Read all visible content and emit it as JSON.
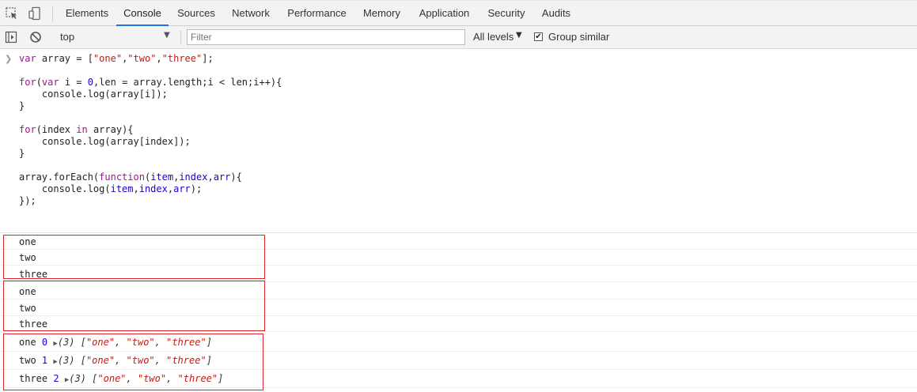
{
  "tabs": [
    {
      "label": "Elements",
      "active": false
    },
    {
      "label": "Console",
      "active": true
    },
    {
      "label": "Sources",
      "active": false
    },
    {
      "label": "Network",
      "active": false
    },
    {
      "label": "Performance",
      "active": false
    },
    {
      "label": "Memory",
      "active": false
    },
    {
      "label": "Application",
      "active": false
    },
    {
      "label": "Security",
      "active": false
    },
    {
      "label": "Audits",
      "active": false
    }
  ],
  "toolbar": {
    "context": "top",
    "filter_placeholder": "Filter",
    "levels": "All levels",
    "group_similar_label": "Group similar",
    "group_similar_checked": true
  },
  "icons": {
    "inspect": "inspect-element-icon",
    "device": "device-toolbar-icon",
    "sidebar": "console-sidebar-icon",
    "clear": "clear-console-icon",
    "prompt": "prompt-chevron-icon",
    "expand": "expand-triangle-icon"
  },
  "colors": {
    "active_tab": "#1a73e8",
    "keyword": "#aa0d91",
    "string": "#c41a16",
    "number": "#1c00cf",
    "highlight_box": "#d9262c"
  },
  "code_lines": [
    "var array = [\"one\",\"two\",\"three\"];",
    "",
    "for(var i = 0,len = array.length;i < len;i++){",
    "    console.log(array[i]);",
    "}",
    "",
    "for(index in array){",
    "    console.log(array[index]);",
    "}",
    "",
    "array.forEach(function(item,index,arr){",
    "    console.log(item,index,arr);",
    "});"
  ],
  "output_group1": [
    "one",
    "two",
    "three"
  ],
  "output_group2": [
    "one",
    "two",
    "three"
  ],
  "output_group3": [
    {
      "item": "one",
      "index": "0",
      "len": "(3)",
      "array": [
        "\"one\"",
        "\"two\"",
        "\"three\""
      ]
    },
    {
      "item": "two",
      "index": "1",
      "len": "(3)",
      "array": [
        "\"one\"",
        "\"two\"",
        "\"three\""
      ]
    },
    {
      "item": "three",
      "index": "2",
      "len": "(3)",
      "array": [
        "\"one\"",
        "\"two\"",
        "\"three\""
      ]
    }
  ]
}
